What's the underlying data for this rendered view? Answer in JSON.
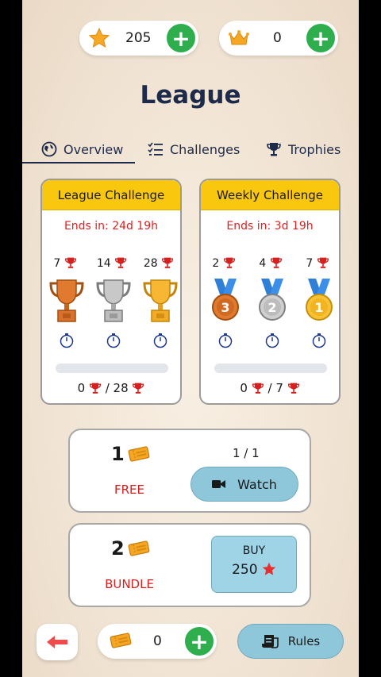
{
  "header": {
    "stars": {
      "value": "205",
      "icon": "star-icon"
    },
    "crowns": {
      "value": "0",
      "icon": "crown-icon"
    },
    "plus_symbol": "+"
  },
  "title": "League",
  "tabs": [
    {
      "label": "Overview",
      "icon": "globe-icon",
      "active": true
    },
    {
      "label": "Challenges",
      "icon": "checklist-icon",
      "active": false
    },
    {
      "label": "Trophies",
      "icon": "trophy-icon",
      "active": false
    }
  ],
  "league_card": {
    "title": "League Challenge",
    "ends": "Ends in: 24d 19h",
    "goals": [
      "7",
      "14",
      "28"
    ],
    "prizes": [
      "bronze-trophy",
      "silver-trophy",
      "gold-trophy"
    ],
    "progress_fraction": 0,
    "progress_current": "0",
    "progress_target": "28",
    "separator": "/"
  },
  "weekly_card": {
    "title": "Weekly Challenge",
    "ends": "Ends in: 3d 19h",
    "goals": [
      "2",
      "4",
      "7"
    ],
    "prizes": [
      "bronze-medal-3",
      "silver-medal-2",
      "gold-medal-1"
    ],
    "medal_numbers": [
      "3",
      "2",
      "1"
    ],
    "progress_fraction": 0,
    "progress_current": "0",
    "progress_target": "7",
    "separator": "/"
  },
  "free_offer": {
    "qty": "1",
    "kind": "FREE",
    "count": "1 / 1",
    "button": "Watch"
  },
  "bundle_offer": {
    "qty": "2",
    "kind": "BUNDLE",
    "buy_label": "BUY",
    "price": "250"
  },
  "bottom": {
    "tickets": "0",
    "rules_label": "Rules"
  },
  "colors": {
    "accent_green": "#2fae4e",
    "card_header": "#f9c80e",
    "alert_red": "#e02020",
    "button_blue": "#8ec7d9"
  }
}
